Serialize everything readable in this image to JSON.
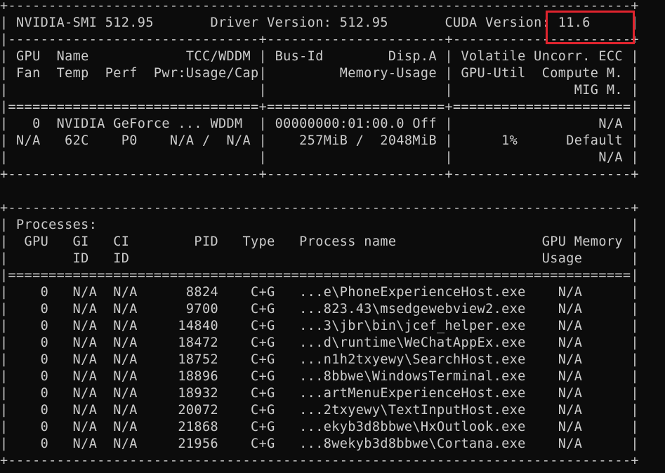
{
  "terminal": {
    "background": "#0c0c0c",
    "foreground": "#cccccc",
    "lines": [
      "+-----------------------------------------------------------------------------+",
      "| NVIDIA-SMI 512.95       Driver Version: 512.95       CUDA Version: 11.6     |",
      "|-------------------------------+----------------------+----------------------+",
      "| GPU  Name            TCC/WDDM | Bus-Id        Disp.A | Volatile Uncorr. ECC |",
      "| Fan  Temp  Perf  Pwr:Usage/Cap|         Memory-Usage | GPU-Util  Compute M. |",
      "|                               |                      |               MIG M. |",
      "|===============================+======================+======================|",
      "|   0  NVIDIA GeForce ... WDDM  | 00000000:01:00.0 Off |                  N/A |",
      "| N/A   62C    P0    N/A /  N/A |    257MiB /  2048MiB |      1%      Default |",
      "|                               |                      |                  N/A |",
      "+-------------------------------+----------------------+----------------------+",
      "",
      "+-----------------------------------------------------------------------------+",
      "| Processes:                                                                  |",
      "|  GPU   GI   CI        PID   Type   Process name                  GPU Memory |",
      "|        ID   ID                                                   Usage      |",
      "|=============================================================================|",
      "|    0   N/A  N/A      8824    C+G   ...e\\PhoneExperienceHost.exe    N/A      |",
      "|    0   N/A  N/A      9700    C+G   ...823.43\\msedgewebview2.exe    N/A      |",
      "|    0   N/A  N/A     14840    C+G   ...3\\jbr\\bin\\jcef_helper.exe    N/A      |",
      "|    0   N/A  N/A     18472    C+G   ...d\\runtime\\WeChatAppEx.exe    N/A      |",
      "|    0   N/A  N/A     18752    C+G   ...n1h2txyewy\\SearchHost.exe    N/A      |",
      "|    0   N/A  N/A     18896    C+G   ...8bbwe\\WindowsTerminal.exe    N/A      |",
      "|    0   N/A  N/A     18932    C+G   ...artMenuExperienceHost.exe    N/A      |",
      "|    0   N/A  N/A     20072    C+G   ...2txyewy\\TextInputHost.exe    N/A      |",
      "|    0   N/A  N/A     21868    C+G   ...ekyb3d8bbwe\\HxOutlook.exe    N/A      |",
      "|    0   N/A  N/A     21956    C+G   ...8wekyb3d8bbwe\\Cortana.exe    N/A      |",
      "+-----------------------------------------------------------------------------+"
    ]
  },
  "annotation": {
    "color": "#e0242e"
  }
}
